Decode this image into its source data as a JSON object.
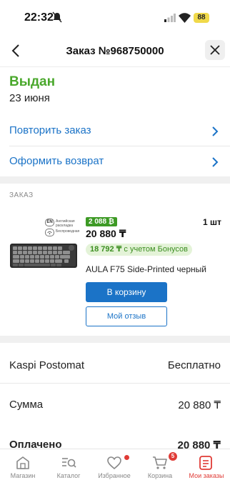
{
  "status_bar": {
    "time": "22:32",
    "battery": "88"
  },
  "header": {
    "title": "Заказ №968750000"
  },
  "order": {
    "status": "Выдан",
    "date": "23 июня"
  },
  "actions": {
    "repeat_label": "Повторить заказ",
    "return_label": "Оформить возврат"
  },
  "section": {
    "label": "ЗАКАЗ"
  },
  "product": {
    "badge_en": "EN",
    "badge_en_text_1": "Английская",
    "badge_en_text_2": "раскладка",
    "badge_wireless_text": "Беспроводная",
    "bonus_tag": "2 088 ₿",
    "price": "20 880 ₸",
    "quantity": "1 шт",
    "bonus_price": "18 792 ₸",
    "bonus_suffix": " с учетом Бонусов",
    "name": "AULA F75 Side-Printed черный",
    "cart_button": "В корзину",
    "review_button": "Мой отзыв"
  },
  "summary": {
    "delivery_label": "Kaspi Postomat",
    "delivery_value": "Бесплатно",
    "sum_label": "Сумма",
    "sum_value": "20 880 ₸",
    "paid_label": "Оплачено",
    "paid_value": "20 880 ₸"
  },
  "bottom_nav": {
    "items": [
      {
        "label": "Магазин",
        "icon": "store-icon"
      },
      {
        "label": "Каталог",
        "icon": "catalog-search-icon"
      },
      {
        "label": "Избранное",
        "icon": "heart-icon"
      },
      {
        "label": "Корзина",
        "icon": "cart-icon"
      },
      {
        "label": "Мои заказы",
        "icon": "orders-icon"
      }
    ],
    "cart_count": "5",
    "active_index": 4
  },
  "colors": {
    "accent_blue": "#1b73c7",
    "success_green": "#4aa82c",
    "active_red": "#e03b36"
  }
}
